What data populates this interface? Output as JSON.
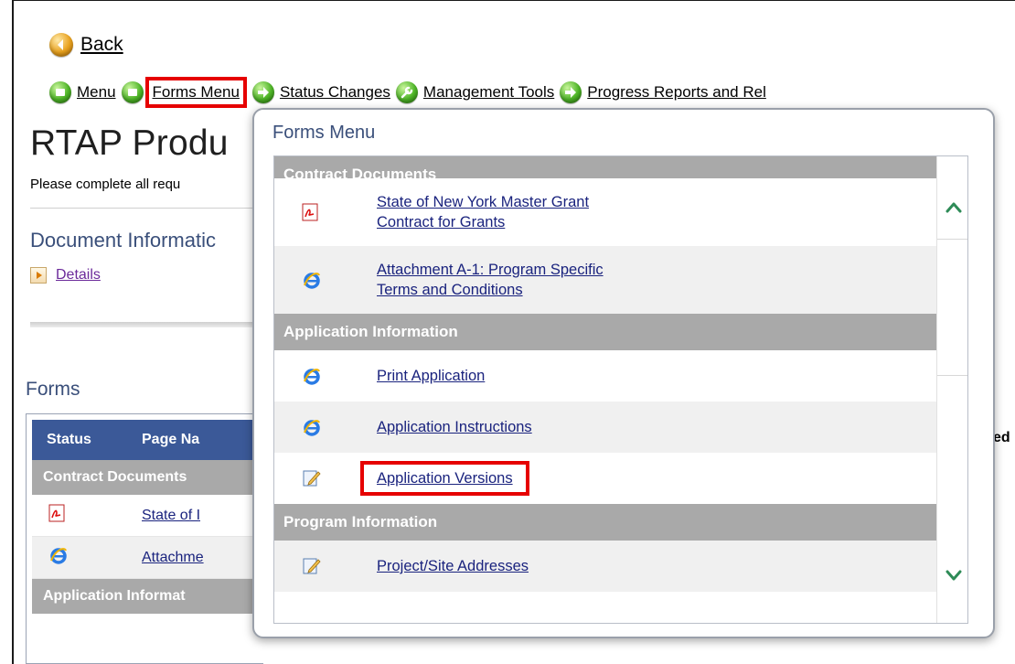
{
  "nav": {
    "back_label": "Back",
    "items": [
      {
        "label": "Menu",
        "icon": "green-circle-icon"
      },
      {
        "label": "Forms Menu",
        "icon": "green-circle-icon"
      },
      {
        "label": "Status Changes",
        "icon": "green-arrow-icon"
      },
      {
        "label": "Management Tools",
        "icon": "green-wrench-icon"
      },
      {
        "label": "Progress Reports and Rel",
        "icon": "green-arrow-icon"
      }
    ]
  },
  "page": {
    "title": "RTAP Produ",
    "instruction": "Please complete all requ",
    "document_section": "Document Informatic",
    "details_label": "Details",
    "forms_title": "Forms",
    "right_edge_text": "ed"
  },
  "table": {
    "headers": [
      "Status",
      "Page Na"
    ],
    "group1": "Contract Documents",
    "rows": [
      {
        "icon": "pdf-icon",
        "name": "State of I"
      },
      {
        "icon": "ie-icon",
        "name": "Attachme"
      }
    ],
    "group2": "Application Informat"
  },
  "popup": {
    "title": "Forms Menu",
    "cut_group": "Contract Documents",
    "rows_contract": [
      {
        "icon": "pdf-icon",
        "line1": "State of New York Master Grant",
        "line2": "Contract for Grants"
      },
      {
        "icon": "ie-icon",
        "line1": "Attachment A-1: Program Specific",
        "line2": "Terms and Conditions"
      }
    ],
    "group_application": "Application Information",
    "rows_application": [
      {
        "icon": "ie-icon",
        "label": "Print Application"
      },
      {
        "icon": "ie-icon",
        "label": "Application Instructions"
      },
      {
        "icon": "edit-icon",
        "label": "Application Versions"
      }
    ],
    "group_program": "Program Information",
    "rows_program": [
      {
        "icon": "edit-icon",
        "label": "Project/Site Addresses"
      }
    ]
  },
  "colors": {
    "highlight": "#e60000",
    "header_blue": "#3b5998",
    "group_gray": "#a9a9a9",
    "link_blue": "#1a237e",
    "scroll_green": "#2e8b57"
  }
}
